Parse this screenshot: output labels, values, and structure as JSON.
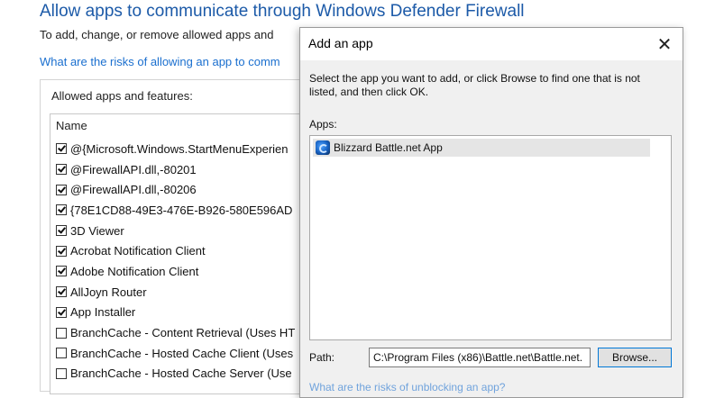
{
  "background": {
    "title": "Allow apps to communicate through Windows Defender Firewall",
    "description": "To add, change, or remove allowed apps and",
    "risk_link": "What are the risks of allowing an app to comm",
    "allowed_label": "Allowed apps and features:",
    "list_header": "Name",
    "items": [
      {
        "label": "@{Microsoft.Windows.StartMenuExperien",
        "checked": true
      },
      {
        "label": "@FirewallAPI.dll,-80201",
        "checked": true
      },
      {
        "label": "@FirewallAPI.dll,-80206",
        "checked": true
      },
      {
        "label": "{78E1CD88-49E3-476E-B926-580E596AD",
        "checked": true
      },
      {
        "label": "3D Viewer",
        "checked": true
      },
      {
        "label": "Acrobat Notification Client",
        "checked": true
      },
      {
        "label": "Adobe Notification Client",
        "checked": true
      },
      {
        "label": "AllJoyn Router",
        "checked": true
      },
      {
        "label": "App Installer",
        "checked": true
      },
      {
        "label": "BranchCache - Content Retrieval (Uses HT",
        "checked": false
      },
      {
        "label": "BranchCache - Hosted Cache Client (Uses",
        "checked": false
      },
      {
        "label": "BranchCache - Hosted Cache Server (Use",
        "checked": false
      }
    ]
  },
  "dialog": {
    "title": "Add an app",
    "close_glyph": "✕",
    "instruction": "Select the app you want to add, or click Browse to find one that is not listed, and then click OK.",
    "apps_label": "Apps:",
    "apps": [
      {
        "label": "Blizzard Battle.net App",
        "icon": "battlenet-icon"
      }
    ],
    "path_label": "Path:",
    "path_value": "C:\\Program Files (x86)\\Battle.net\\Battle.net.",
    "browse_label": "Browse...",
    "bottom_link": "What are the risks of unblocking an app?"
  }
}
